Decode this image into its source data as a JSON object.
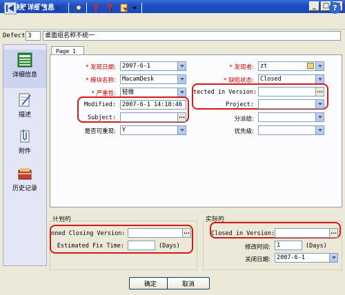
{
  "window": {
    "title": "缺陷详细信息",
    "buttons": [
      "_",
      "□",
      "X"
    ]
  },
  "toolbar": {
    "icons": [
      "first-record-icon",
      "prev-record-icon",
      "next-record-icon",
      "last-record-icon",
      "find-icon",
      "filter-icon",
      "filter-clear-icon",
      "page-menu-icon",
      "dropdown-arrow-icon",
      "help-icon"
    ],
    "help_label": "?"
  },
  "defect": {
    "label": "Defect",
    "number": "3",
    "summary": "桌面组名称不统一"
  },
  "nav": {
    "items": [
      {
        "label": "详细信息",
        "icon": "details-icon"
      },
      {
        "label": "描述",
        "icon": "description-icon"
      },
      {
        "label": "附件",
        "icon": "attachment-icon"
      },
      {
        "label": "历史记录",
        "icon": "history-icon"
      }
    ]
  },
  "tab": {
    "label": "Page 1"
  },
  "form": {
    "detected_date": {
      "label": "发现日期:",
      "value": "2007-6-1"
    },
    "detected_by": {
      "label": "发现者:",
      "value": "zt"
    },
    "module": {
      "label": "模块名称:",
      "value": "MacamDesk"
    },
    "status": {
      "label": "缺陷状态:",
      "value": "Closed"
    },
    "severity": {
      "label": "严重性:",
      "value": "轻微"
    },
    "detected_in_version": {
      "label": "tected in Version:",
      "value": ""
    },
    "modified": {
      "label": "Modified:",
      "value": "2007-6-1 14:18:46"
    },
    "project": {
      "label": "Project:",
      "value": ""
    },
    "subject": {
      "label": "Subject:",
      "value": ""
    },
    "assigned_to": {
      "label": "分派给:",
      "value": ""
    },
    "reproducible": {
      "label": "是否可重现:",
      "value": "Y"
    },
    "priority": {
      "label": "优先级:",
      "value": ""
    },
    "required_mark": "*",
    "ellipsis": "..."
  },
  "planning": {
    "title": "计划的",
    "closing_version": {
      "label": "nned Closing Version:",
      "value": ""
    },
    "fix_time": {
      "label": "Estimated Fix Time:",
      "value": "",
      "unit": "(Days)"
    }
  },
  "actual": {
    "title": "实际的",
    "closed_in_version": {
      "label": "Closed in Version:",
      "value": ""
    },
    "fix_time": {
      "label": "修改时间:",
      "value": "1",
      "unit": "(Days)"
    },
    "closing_date": {
      "label": "关闭日期:",
      "value": "2007-6-1"
    }
  },
  "buttons": {
    "ok": "确定",
    "cancel": "取消"
  },
  "colors": {
    "highlight": "#d01818",
    "titlebar": "#1d4fc4",
    "required": "#d00000"
  }
}
